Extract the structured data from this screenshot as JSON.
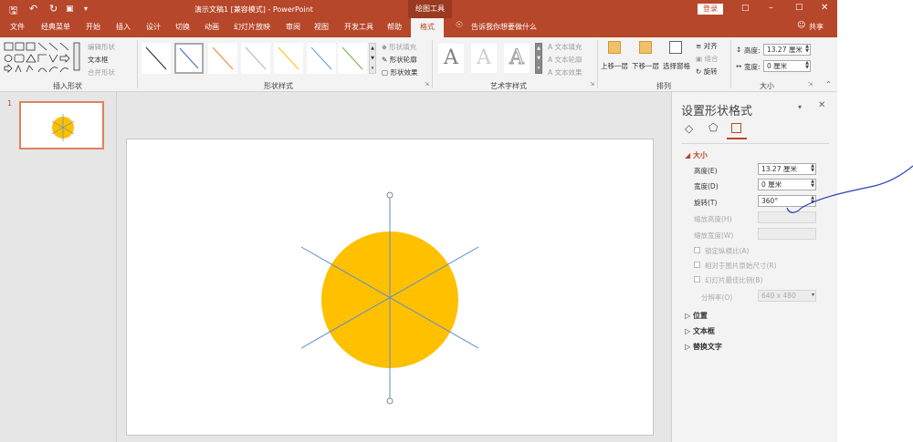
{
  "titlebar": {
    "title": "演示文稿1 [兼容模式] - PowerPoint",
    "context_tab": "绘图工具",
    "login": "登录",
    "qat_undo": "↶",
    "qat_redo": "↻"
  },
  "tabs": [
    "文件",
    "经典菜单",
    "开始",
    "插入",
    "设计",
    "切换",
    "动画",
    "幻灯片放映",
    "审阅",
    "视图",
    "开发工具",
    "帮助",
    "格式"
  ],
  "tell_me": "告诉我你想要做什么",
  "share": "共享",
  "ribbon": {
    "insert_shapes": {
      "label": "插入形状",
      "edit_shape": "编辑形状",
      "text_box": "文本框",
      "merge_shapes": "合并形状"
    },
    "shape_styles": {
      "label": "形状样式",
      "fill": "形状填充",
      "outline": "形状轮廓",
      "effects": "形状效果"
    },
    "wordart": {
      "label": "艺术字样式",
      "letter": "A",
      "text_fill": "文本填充",
      "text_outline": "文本轮廓",
      "text_effects": "文本效果"
    },
    "arrange": {
      "label": "排列",
      "bring_forward": "上移一层",
      "send_backward": "下移一层",
      "selection_pane": "选择窗格",
      "align": "对齐",
      "group": "组合",
      "rotate": "旋转"
    },
    "size": {
      "label": "大小",
      "height_label": "高度:",
      "height_value": "13.27 厘米",
      "width_label": "宽度:",
      "width_value": "0 厘米"
    }
  },
  "thumbnails": {
    "slide_number": "1"
  },
  "format_pane": {
    "title": "设置形状格式",
    "size_section": "大小",
    "height_label": "高度(E)",
    "height_value": "13.27 厘米",
    "width_label": "宽度(D)",
    "width_value": "0 厘米",
    "rotation_label": "旋转(T)",
    "rotation_value": "360°",
    "scale_height": "缩放高度(H)",
    "scale_width": "缩放宽度(W)",
    "lock_aspect": "锁定纵横比(A)",
    "relative_to_picture": "相对于图片原始尺寸(R)",
    "best_for_slideshow": "幻灯片最佳比例(B)",
    "resolution_label": "分辨率(O)",
    "resolution_value": "640 x 480",
    "position_section": "位置",
    "textbox_section": "文本框",
    "alt_text_section": "替换文字"
  },
  "colors": {
    "accent": "#b7472a",
    "circle": "#ffc000",
    "line": "#5b8bd0"
  }
}
